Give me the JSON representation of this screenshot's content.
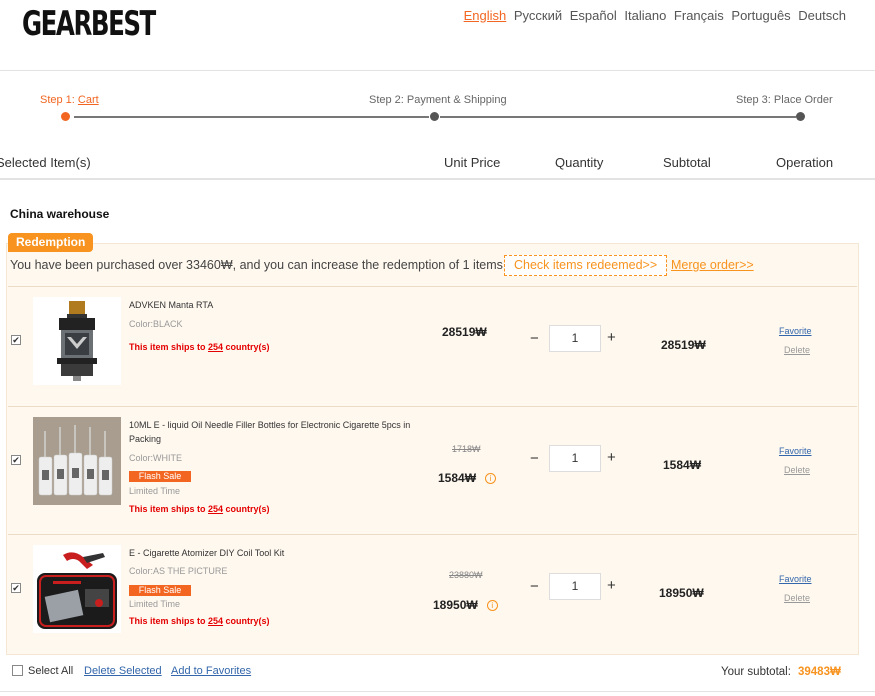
{
  "brand": {
    "logo": "GEARBEST"
  },
  "languages": [
    {
      "label": "English",
      "active": true
    },
    {
      "label": "Русский"
    },
    {
      "label": "Español"
    },
    {
      "label": "Italiano"
    },
    {
      "label": "Français"
    },
    {
      "label": "Português"
    },
    {
      "label": "Deutsch"
    }
  ],
  "steps": {
    "step1_prefix": "Step 1: ",
    "step1_link": "Cart",
    "step2": "Step 2: Payment & Shipping",
    "step3": "Step 3: Place Order"
  },
  "columns": {
    "items": "Selected Item(s)",
    "unit_price": "Unit Price",
    "quantity": "Quantity",
    "subtotal": "Subtotal",
    "operation": "Operation"
  },
  "warehouse": "China warehouse",
  "redemption": {
    "badge": "Redemption",
    "message": "You have been purchased over 33460₩, and you can increase the redemption of 1 items",
    "check_button": "Check items redeemed>>",
    "merge_link": "Merge order>>"
  },
  "items": [
    {
      "name": "ADVKEN Manta RTA",
      "color": "Color:BLACK",
      "ships_prefix": "This item ships to ",
      "ships_count": "254",
      "ships_suffix": " country(s)",
      "price": "28519₩",
      "quantity": "1",
      "subtotal": "28519₩",
      "favorite": "Favorite",
      "delete": "Delete"
    },
    {
      "name": "10ML E - liquid Oil Needle Filler Bottles for Electronic Cigarette 5pcs in Packing",
      "color": "Color:WHITE",
      "flash": "Flash Sale",
      "limited": "Limited Time",
      "ships_prefix": "This item ships to ",
      "ships_count": "254",
      "ships_suffix": " country(s)",
      "old_price": "1718₩",
      "price": "1584₩",
      "quantity": "1",
      "subtotal": "1584₩",
      "favorite": "Favorite",
      "delete": "Delete"
    },
    {
      "name": "E - Cigarette Atomizer DIY Coil Tool Kit",
      "color": "Color:AS THE PICTURE",
      "flash": "Flash Sale",
      "limited": "Limited Time",
      "ships_prefix": "This item ships to ",
      "ships_count": "254",
      "ships_suffix": " country(s)",
      "old_price": "23880₩",
      "price": "18950₩",
      "quantity": "1",
      "subtotal": "18950₩",
      "favorite": "Favorite",
      "delete": "Delete"
    }
  ],
  "footer": {
    "select_all": "Select All",
    "delete_selected": "Delete Selected",
    "add_to_favorites": "Add to Favorites",
    "subtotal_label": "Your subtotal: ",
    "subtotal_value": "39483₩"
  },
  "symbols": {
    "minus": "−",
    "plus": "+",
    "check": "✔",
    "info": "i"
  },
  "colors": {
    "accent": "#f26622",
    "redemption": "#f7931e",
    "link": "#3366aa",
    "alert": "#e40000"
  }
}
